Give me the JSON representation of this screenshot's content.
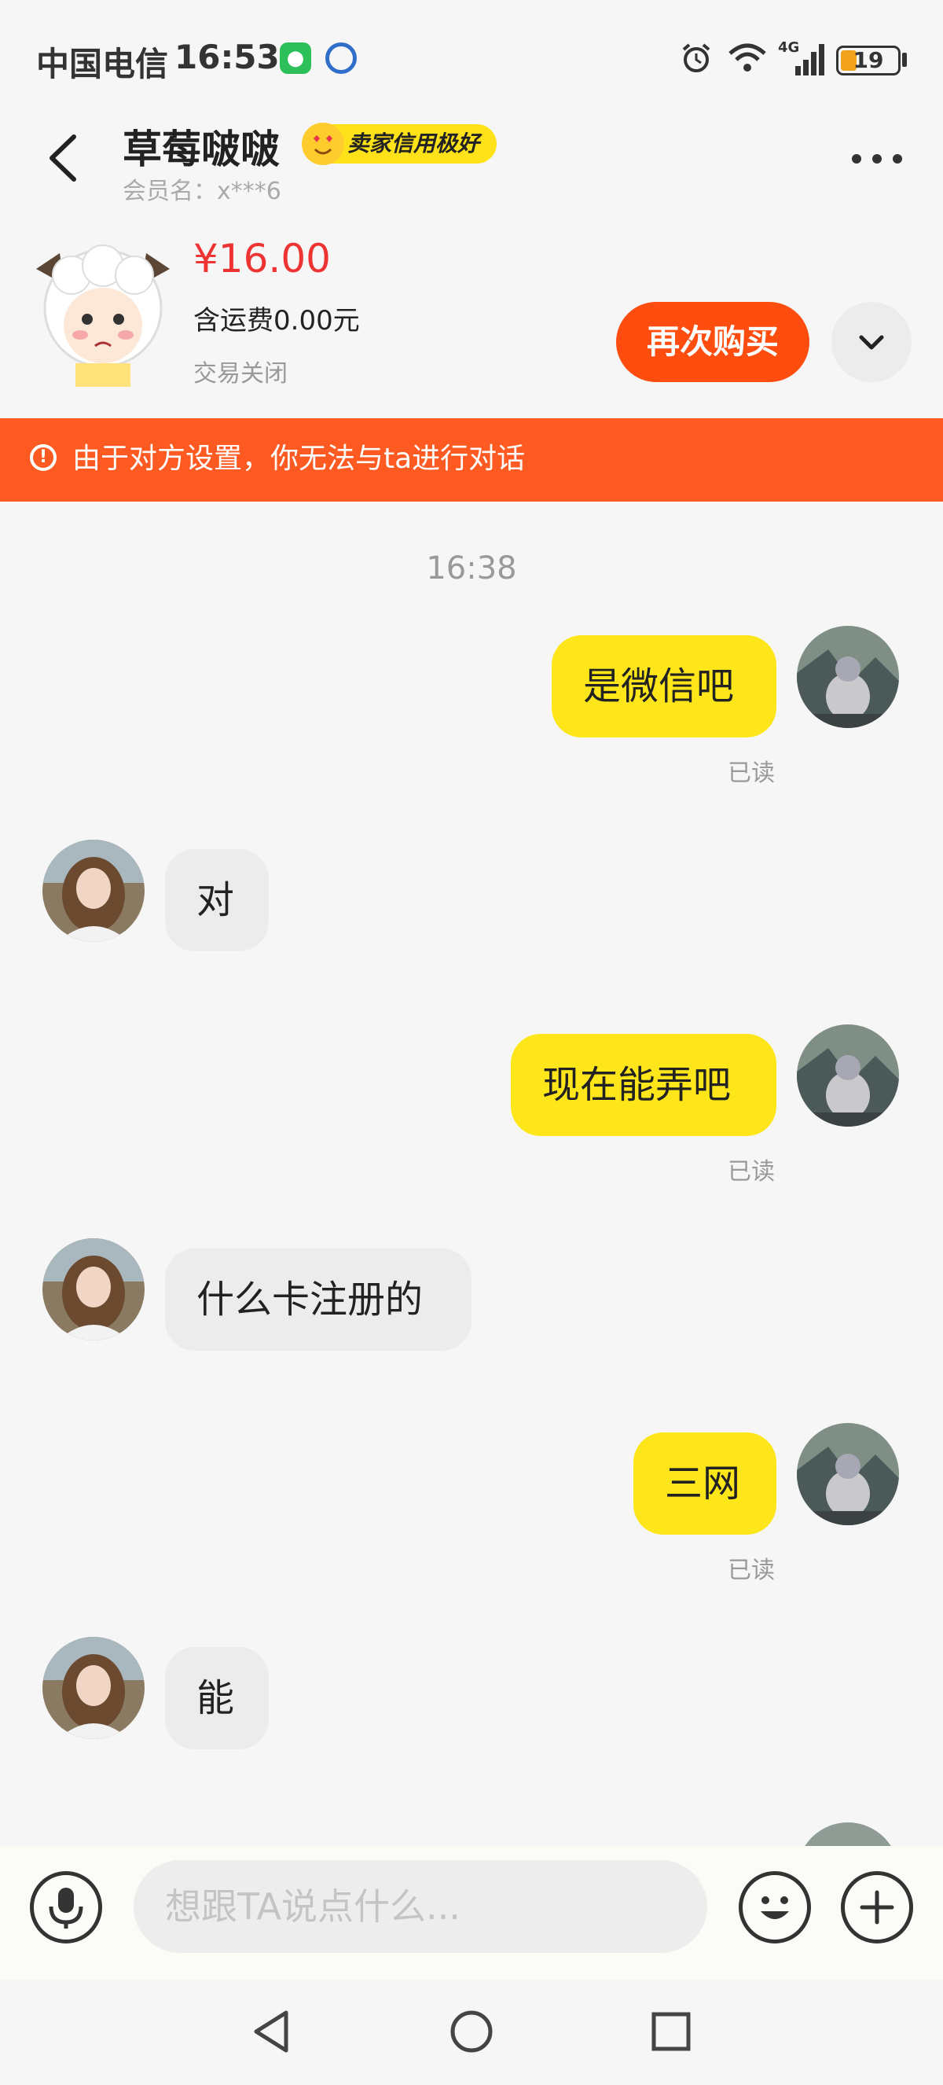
{
  "status_bar": {
    "carrier": "中国电信",
    "time": "16:53",
    "network": "4G",
    "battery": "19"
  },
  "header": {
    "contact_name": "草莓啵啵",
    "credit_badge": "卖家信用极好",
    "member_name": "会员名：x***6"
  },
  "product": {
    "price": "¥16.00",
    "shipping": "含运费0.00元",
    "trade_status": "交易关闭",
    "buy_again": "再次购买"
  },
  "banner": {
    "text": "由于对方设置，你无法与ta进行对话",
    "icon": "exclamation-circle-icon"
  },
  "chat": {
    "timestamp": "16:38",
    "messages": [
      {
        "sender": "me",
        "text": "是微信吧",
        "status": "已读"
      },
      {
        "sender": "them",
        "text": "对"
      },
      {
        "sender": "me",
        "text": "现在能弄吧",
        "status": "已读"
      },
      {
        "sender": "them",
        "text": "什么卡注册的"
      },
      {
        "sender": "me",
        "text": "三网",
        "status": "已读"
      },
      {
        "sender": "them",
        "text": "能"
      }
    ]
  },
  "input": {
    "placeholder": "想跟TA说点什么..."
  },
  "colors": {
    "accent": "#ff4d10",
    "banner": "#ff5a22",
    "my_bubble": "#ffe61a",
    "their_bubble": "#ececec",
    "price": "#ee3333"
  }
}
